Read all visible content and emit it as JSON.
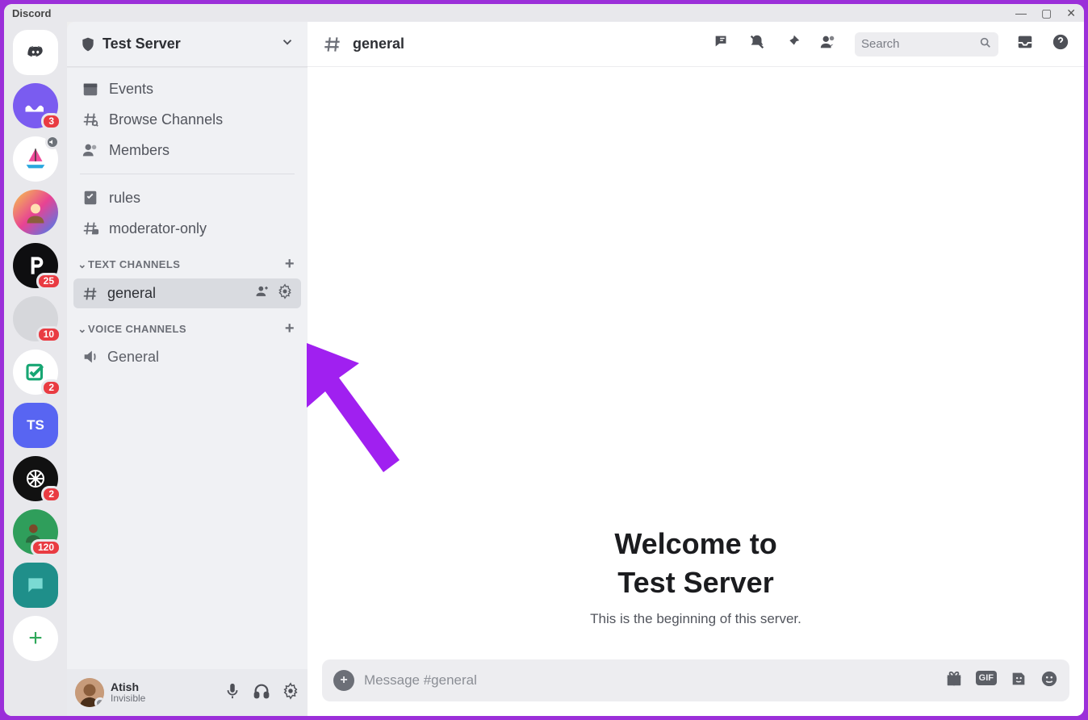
{
  "window": {
    "title": "Discord"
  },
  "server_rail": {
    "badges": {
      "s1": "3",
      "s4": "25",
      "s5": "10",
      "s6": "2",
      "s7": "2",
      "s8": "120"
    },
    "ts": "TS"
  },
  "sidebar": {
    "server_name": "Test Server",
    "nav": {
      "events": "Events",
      "browse": "Browse Channels",
      "members": "Members",
      "rules": "rules",
      "mod": "moderator-only"
    },
    "categories": {
      "text": "TEXT CHANNELS",
      "voice": "VOICE CHANNELS"
    },
    "channels": {
      "general": "general",
      "voice_general": "General"
    }
  },
  "user": {
    "name": "Atish",
    "status": "Invisible"
  },
  "header": {
    "channel": "general",
    "search_placeholder": "Search"
  },
  "chat": {
    "welcome_line1": "Welcome to",
    "welcome_line2": "Test Server",
    "welcome_sub": "This is the beginning of this server.",
    "composer_placeholder": "Message #general",
    "gif": "GIF"
  }
}
